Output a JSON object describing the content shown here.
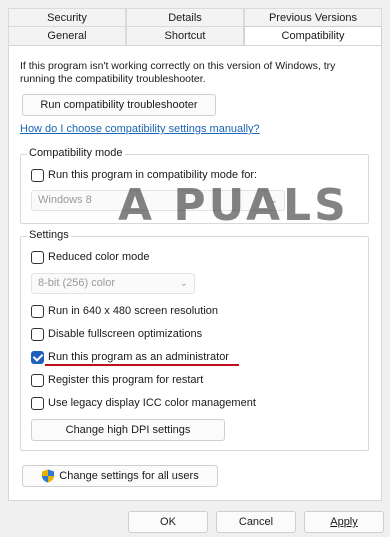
{
  "tabs": {
    "row1": [
      "Security",
      "Details",
      "Previous Versions"
    ],
    "row2": [
      "General",
      "Shortcut",
      "Compatibility"
    ],
    "active": "Compatibility"
  },
  "intro_text": "If this program isn't working correctly on this version of Windows, try running the compatibility troubleshooter.",
  "run_troubleshooter_label": "Run compatibility troubleshooter",
  "manual_link": "How do I choose compatibility settings manually?",
  "compatibility_mode": {
    "title": "Compatibility mode",
    "checkbox_label": "Run this program in compatibility mode for:",
    "checked": false,
    "os_value": "Windows 8"
  },
  "settings": {
    "title": "Settings",
    "reduced_color": {
      "label": "Reduced color mode",
      "checked": false
    },
    "color_value": "8-bit (256) color",
    "res_640": {
      "label": "Run in 640 x 480 screen resolution",
      "checked": false
    },
    "disable_fullscreen": {
      "label": "Disable fullscreen optimizations",
      "checked": false
    },
    "run_admin": {
      "label": "Run this program as an administrator",
      "checked": true
    },
    "register_restart": {
      "label": "Register this program for restart",
      "checked": false
    },
    "legacy_icc": {
      "label": "Use legacy display ICC color management",
      "checked": false
    },
    "high_dpi_label": "Change high DPI settings"
  },
  "change_all_users_label": "Change settings for all users",
  "watermark_text": "A PUALS",
  "footer": {
    "ok": "OK",
    "cancel": "Cancel",
    "apply": "Apply"
  },
  "colors": {
    "accent": "#1d5fbf",
    "link": "#1a66b6",
    "annotation": "#c0101a"
  }
}
